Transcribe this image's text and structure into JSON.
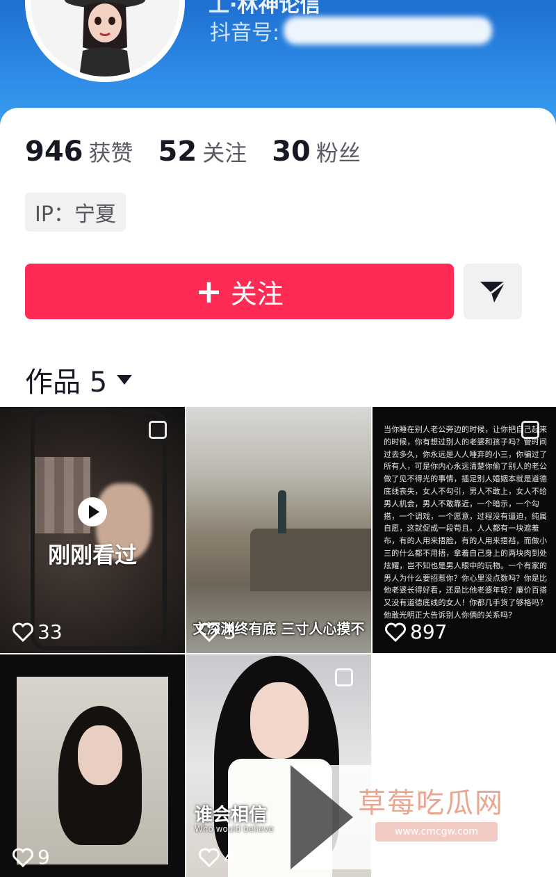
{
  "header": {
    "name_partial": "工·林神论信",
    "douyin_label": "抖音号:"
  },
  "stats": [
    {
      "value": "946",
      "label": "获赞"
    },
    {
      "value": "52",
      "label": "关注"
    },
    {
      "value": "30",
      "label": "粉丝"
    }
  ],
  "ip": "IP：宁夏",
  "follow_button": {
    "plus": "+",
    "label": "关注"
  },
  "share_icon": "send-icon",
  "works_tab": {
    "label": "作品 5"
  },
  "videos": [
    {
      "overlay": "刚刚看过",
      "likes": "33"
    },
    {
      "caption": "文深渊终有底 三寸人心摸不",
      "likes": "3"
    },
    {
      "text": "当你睡在别人老公旁边的时候，让你把自己起来的时候，你有想过别人的老婆和孩子吗？管时间过去多久，你永远是人人唾弃的小三，你骗过了所有人，可是你内心永远清楚你偷了别人的老公做了见不得光的事情，插足别人婚姻本就是道德底线丧失，女人不勾引，男人不敢上，女人不给男人机会，男人不敢靠近，一个暗示，一个勾搭，一个调戏，一个愿意，过程没有逼迫，纯属自愿，这就促成一段苟且。人人都有一块遮羞布，有的人用来捂脸，有的人用来捂裆，而做小三的什么都不用捂，拿着自己身上的两块肉到处炫耀，岂不知也是男人眼中的玩物。一个有家的男人为什么要招惹你？你心里没点数吗？你是比他老婆长得好看，还是比他老婆年轻？廉价百搭又没有道德底线的女人！你都几手货了够格吗？他敢光明正大告诉别人你俩的关系吗？",
      "likes": "897"
    },
    {
      "likes": "9"
    },
    {
      "caption": "谁会相信",
      "caption_en": "Who would believe",
      "likes": "4"
    }
  ],
  "watermark": {
    "title": "草莓吃瓜网",
    "url": "www.cmcgw.com"
  },
  "colors": {
    "accent": "#fe2c55",
    "header": "#2d8ae6"
  }
}
